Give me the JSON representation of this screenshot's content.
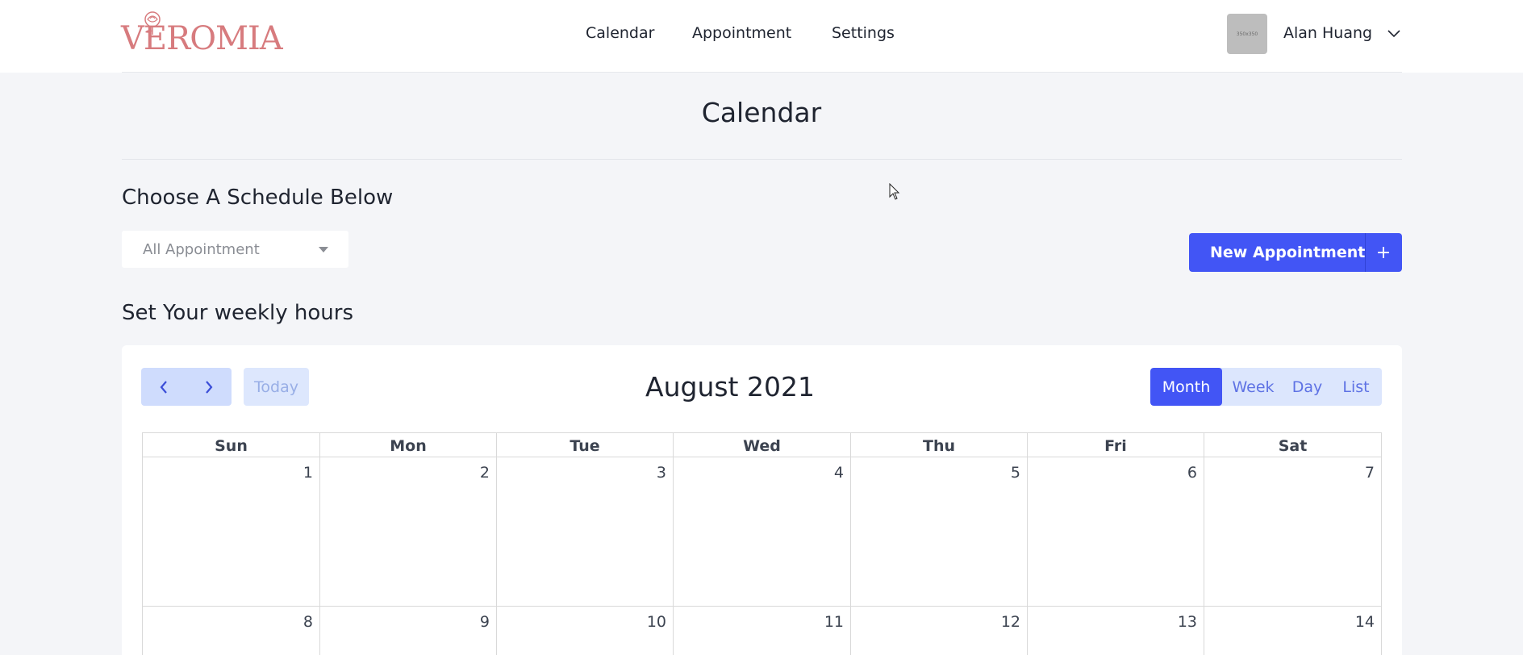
{
  "header": {
    "logo_text": "VEROMIA",
    "nav": [
      "Calendar",
      "Appointment",
      "Settings"
    ],
    "avatar_text": "350x350",
    "user_name": "Alan Huang"
  },
  "page": {
    "title": "Calendar",
    "schedule_heading": "Choose A Schedule Below",
    "schedule_select": {
      "selected": "All Appointment"
    },
    "new_appointment_label": "New Appointment",
    "new_appointment_plus": "+",
    "weekly_heading": "Set Your weekly hours"
  },
  "calendar": {
    "today_label": "Today",
    "month_title": "August 2021",
    "views": [
      "Month",
      "Week",
      "Day",
      "List"
    ],
    "active_view": "Month",
    "days_of_week": [
      "Sun",
      "Mon",
      "Tue",
      "Wed",
      "Thu",
      "Fri",
      "Sat"
    ],
    "weeks": [
      [
        "1",
        "2",
        "3",
        "4",
        "5",
        "6",
        "7"
      ],
      [
        "8",
        "9",
        "10",
        "11",
        "12",
        "13",
        "14"
      ]
    ]
  },
  "colors": {
    "accent": "#4255f5",
    "accent_light": "#cfdcfd",
    "logo": "#d77b7e",
    "page_bg": "#f4f5f8"
  },
  "icons": {
    "prev": "chevron-left-icon",
    "next": "chevron-right-icon",
    "user_menu": "chevron-down-icon",
    "select": "caret-down-icon",
    "add": "plus-icon"
  }
}
